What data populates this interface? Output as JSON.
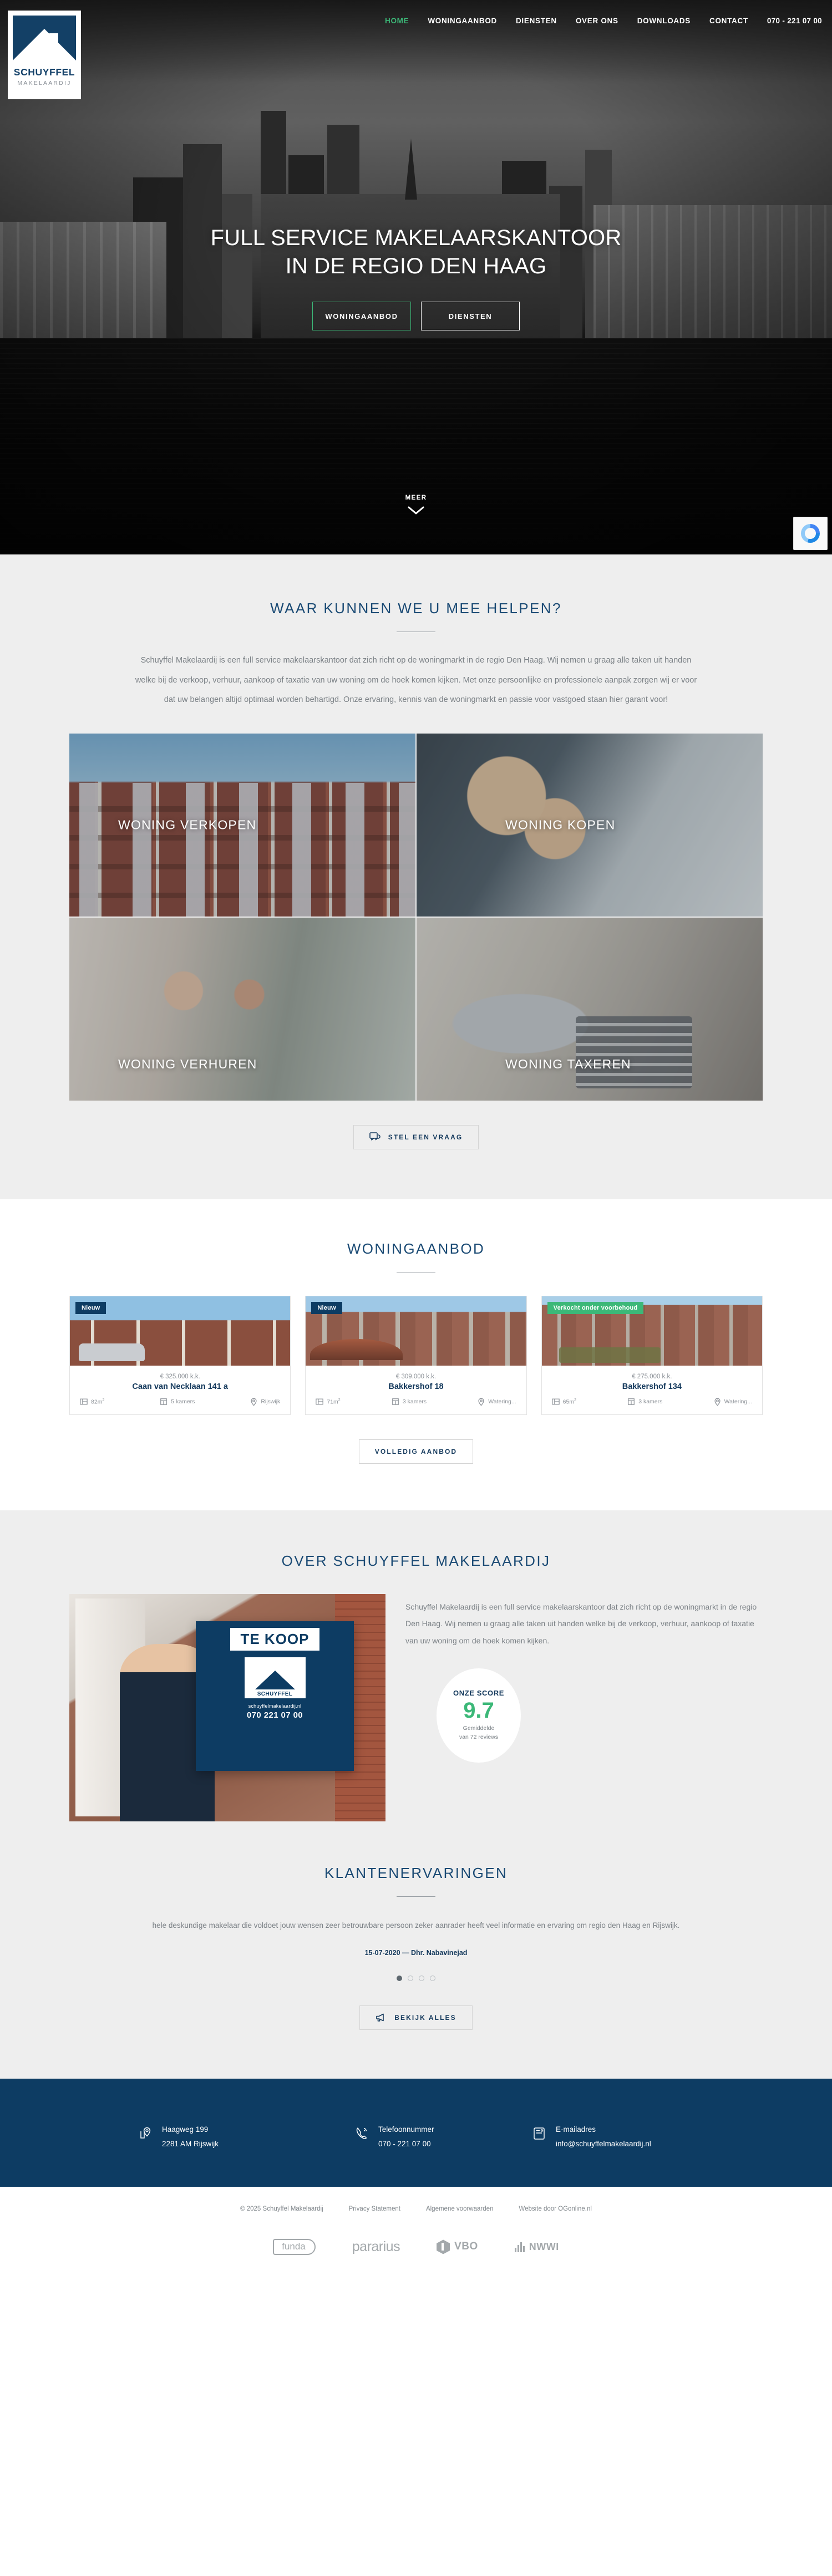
{
  "brand": {
    "logo_name": "SCHUYFFEL",
    "logo_sub": "MAKELAARDIJ"
  },
  "nav": {
    "items": [
      {
        "label": "HOME",
        "active": true
      },
      {
        "label": "WONINGAANBOD",
        "active": false
      },
      {
        "label": "DIENSTEN",
        "active": false
      },
      {
        "label": "OVER ONS",
        "active": false
      },
      {
        "label": "DOWNLOADS",
        "active": false
      },
      {
        "label": "CONTACT",
        "active": false
      }
    ],
    "phone": "070 - 221 07 00"
  },
  "hero": {
    "title_line1": "FULL SERVICE MAKELAARSKANTOOR",
    "title_line2": "IN DE REGIO DEN HAAG",
    "btn_primary": "WONINGAANBOD",
    "btn_secondary": "DIENSTEN",
    "scroll_label": "MEER"
  },
  "help": {
    "title": "WAAR KUNNEN WE U MEE HELPEN?",
    "lead": "Schuyffel Makelaardij is een full service makelaarskantoor dat zich richt op de woningmarkt in de regio Den Haag. Wij nemen u graag alle taken uit handen welke bij de verkoop, verhuur, aankoop of taxatie van uw woning om de hoek komen kijken. Met onze persoonlijke en professionele aanpak zorgen wij er voor dat uw belangen altijd optimaal worden behartigd. Onze ervaring, kennis van de woningmarkt en passie voor vastgoed staan hier garant voor!",
    "tiles": [
      {
        "label": "WONING VERKOPEN"
      },
      {
        "label": "WONING KOPEN"
      },
      {
        "label": "WONING VERHUREN"
      },
      {
        "label": "WONING TAXEREN"
      }
    ],
    "cta": "STEL EEN VRAAG"
  },
  "aanbod": {
    "title": "WONINGAANBOD",
    "cta": "VOLLEDIG AANBOD",
    "listings": [
      {
        "badge": "Nieuw",
        "badge_type": "blue",
        "price": "€ 325.000 k.k.",
        "address": "Caan van Necklaan 141 a",
        "area": "82m",
        "area_unit": "2",
        "rooms": "5 kamers",
        "city": "Rijswijk"
      },
      {
        "badge": "Nieuw",
        "badge_type": "blue",
        "price": "€ 309.000 k.k.",
        "address": "Bakkershof 18",
        "area": "71m",
        "area_unit": "2",
        "rooms": "3 kamers",
        "city": "Watering..."
      },
      {
        "badge": "Verkocht onder voorbehoud",
        "badge_type": "green",
        "price": "€ 275.000 k.k.",
        "address": "Bakkershof 134",
        "area": "65m",
        "area_unit": "2",
        "rooms": "3 kamers",
        "city": "Watering..."
      }
    ]
  },
  "over": {
    "title": "OVER SCHUYFFEL MAKELAARDIJ",
    "text": "Schuyffel Makelaardij is een full service makelaarskantoor dat zich richt op de woningmarkt in de regio Den Haag. Wij nemen u graag alle taken uit handen welke bij de verkoop, verhuur, aankoop of taxatie van uw woning om de hoek komen kijken.",
    "sign": {
      "te_koop": "TE KOOP",
      "logo_name": "SCHUYFFEL",
      "logo_sub": "MAKELAARDIJ",
      "url": "schuyffelmakelaardij.nl",
      "phone": "070 221 07 00"
    },
    "score": {
      "label": "ONZE SCORE",
      "value": "9.7",
      "sub_line1": "Gemiddelde",
      "sub_line2": "van 72 reviews"
    }
  },
  "testimonials": {
    "title": "KLANTENERVARINGEN",
    "quote": "hele deskundige makelaar die voldoet jouw wensen zeer betrouwbare persoon zeker aanrader heeft veel informatie en ervaring om regio den Haag en Rijswijk.",
    "meta": "15-07-2020 — Dhr. Nabavinejad",
    "dots": 4,
    "active_dot": 0,
    "cta": "BEKIJK ALLES"
  },
  "footer": {
    "address_line1": "Haagweg 199",
    "address_line2": "2281 AM Rijswijk",
    "phone_label": "Telefoonnummer",
    "phone_value": "070 - 221 07 00",
    "email_label": "E-mailadres",
    "email_value": "info@schuyffelmakelaardij.nl",
    "copyright": "© 2025 Schuyffel Makelaardij",
    "links": [
      "Privacy Statement",
      "Algemene voorwaarden",
      "Website door OGonline.nl"
    ],
    "partners": [
      "funda",
      "pararius",
      "VBO",
      "NWWI"
    ]
  },
  "colors": {
    "brand_blue": "#0d3c63",
    "accent_green": "#3cb878",
    "heading_blue": "#1a4a74",
    "body_grey": "#7b8186"
  }
}
